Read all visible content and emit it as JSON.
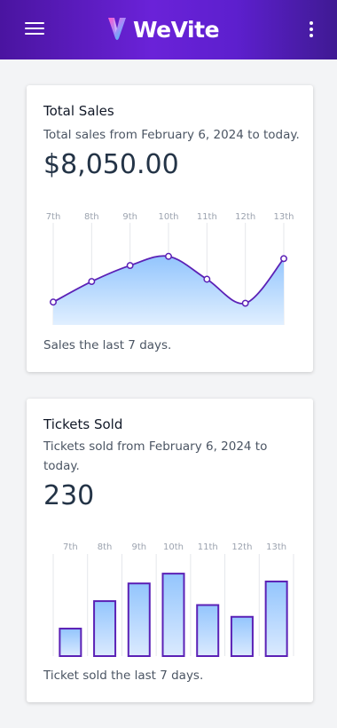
{
  "header": {
    "brand": "WeVite",
    "menu_icon": "hamburger-menu-icon",
    "more_icon": "more-vertical-icon",
    "colors": {
      "start": "#4a14a0",
      "end": "#3f1a93"
    }
  },
  "sales": {
    "title": "Total Sales",
    "subtitle": "Total sales from February 6, 2024 to today.",
    "total": "$8,050.00",
    "footer": "Sales the last 7 days."
  },
  "tickets": {
    "title": "Tickets Sold",
    "subtitle": "Tickets sold from February 6, 2024 to today.",
    "total": "230",
    "footer": "Ticket sold the last 7 days."
  },
  "chart_data": [
    {
      "type": "area",
      "categories": [
        "7th",
        "8th",
        "9th",
        "10th",
        "11th",
        "12th",
        "13th"
      ],
      "values": [
        1.0,
        1.9,
        2.6,
        3.0,
        2.0,
        0.95,
        2.9
      ],
      "ylim": [
        0,
        4
      ],
      "grid": true,
      "colors": {
        "line": "#5b21b6",
        "fill_top": "#93c5fd",
        "fill_bottom": "#e0efff"
      }
    },
    {
      "type": "bar",
      "categories": [
        "7th",
        "8th",
        "9th",
        "10th",
        "11th",
        "12th",
        "13th"
      ],
      "values": [
        14,
        28,
        37,
        42,
        26,
        20,
        38
      ],
      "ylim": [
        0,
        52
      ],
      "grid": true,
      "colors": {
        "stroke": "#5b21b6",
        "fill_top": "#93c5fd",
        "fill_bottom": "#dbeafe"
      }
    }
  ]
}
